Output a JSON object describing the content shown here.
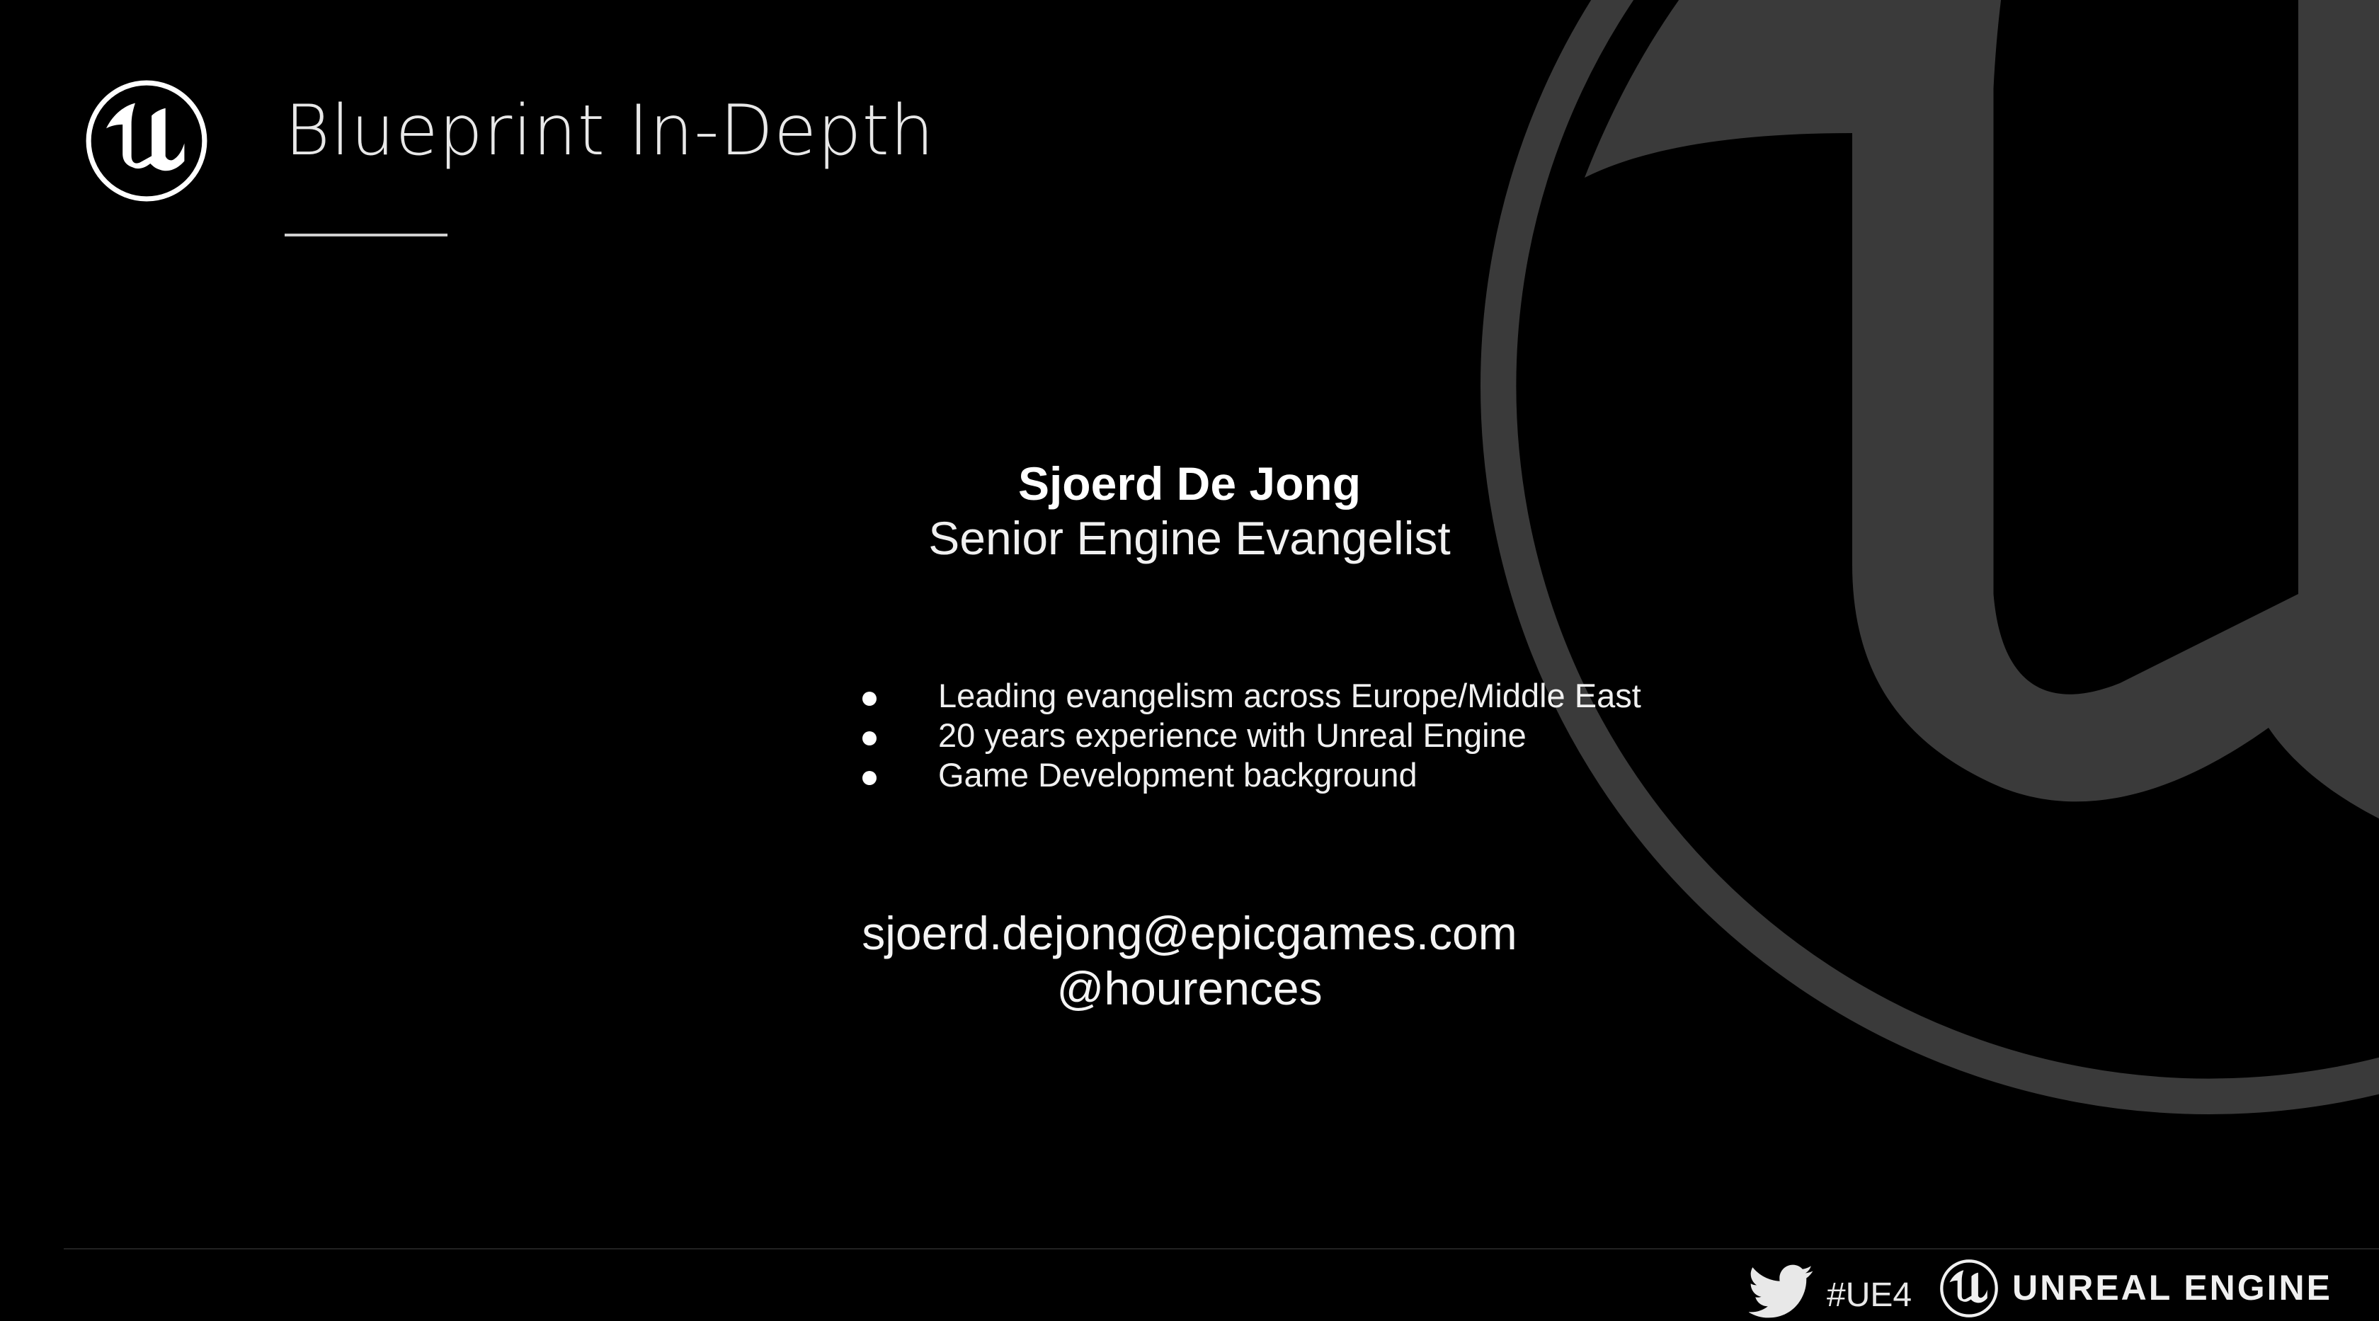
{
  "slide": {
    "title": "Blueprint In-Depth",
    "speaker_name": "Sjoerd De Jong",
    "speaker_role": "Senior Engine Evangelist",
    "bullets": [
      "Leading evangelism across Europe/Middle East",
      "20 years experience with Unreal Engine",
      "Game Development background"
    ],
    "email": "sjoerd.dejong@epicgames.com",
    "handle": "@hourences"
  },
  "footer": {
    "hashtag": "#UE4",
    "brand": "UNREAL ENGINE"
  },
  "icons": {
    "top_logo": "unreal-engine-logo-icon",
    "background_logo": "unreal-engine-logo-icon",
    "twitter": "twitter-bird-icon",
    "footer_logo": "unreal-engine-logo-icon"
  },
  "colors": {
    "background": "#000000",
    "text": "#ffffff",
    "background_logo": "#3a3a3a"
  }
}
